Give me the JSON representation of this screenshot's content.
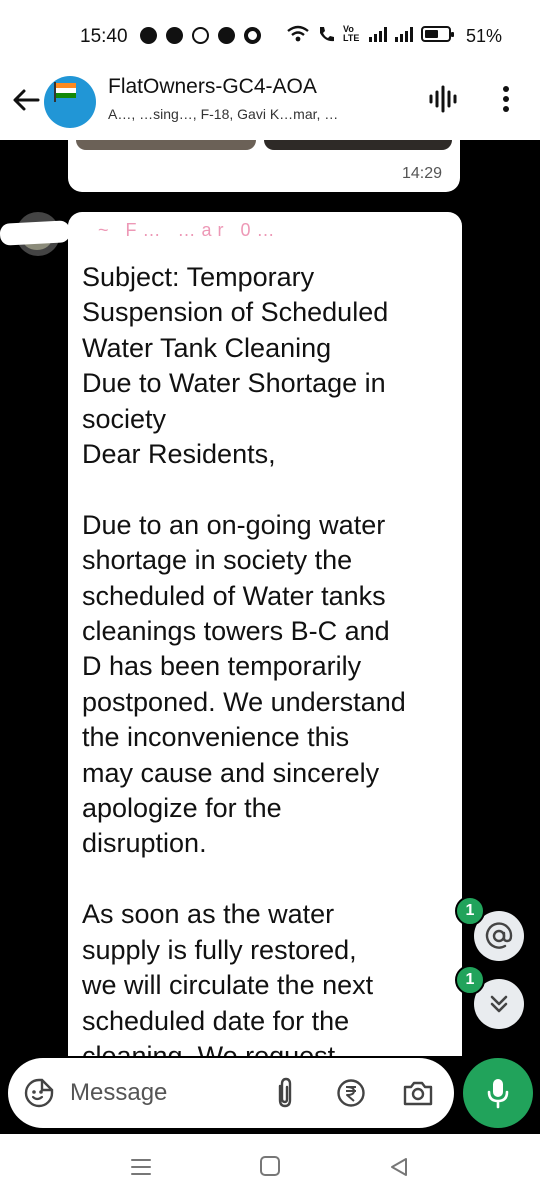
{
  "status_bar": {
    "time": "15:40",
    "network_label": "Vo LTE",
    "battery": "51%"
  },
  "header": {
    "group_name": "FlatOwners-GC4-AOA",
    "members": "A…, …sing…, F-18, Gavi K…mar, …"
  },
  "chat": {
    "previous_message_time": "14:29",
    "message": {
      "sender": "~ F… …ar 0…",
      "lines": [
        "Subject: Temporary",
        "Suspension of Scheduled",
        "Water Tank Cleaning",
        "Due to Water Shortage in",
        "society",
        "Dear Residents,",
        "",
        "Due to an on-going water",
        "shortage in society the",
        "scheduled of Water tanks",
        "cleanings towers B-C and",
        "D has been temporarily",
        "postponed. We understand",
        "the inconvenience this",
        "may cause and sincerely",
        "apologize for the",
        "disruption.",
        "",
        "As soon as the water",
        "supply is fully restored,",
        "we will circulate the next",
        "scheduled date for the",
        "cleaning. We request"
      ]
    },
    "mention_badge": "1",
    "scroll_badge": "1"
  },
  "composer": {
    "placeholder": "Message"
  },
  "icons": {
    "back": "arrow-left-icon",
    "voice": "voice-chat-icon",
    "more": "more-vert-icon",
    "emoji": "sticker-icon",
    "attach": "paperclip-icon",
    "payment": "rupee-icon",
    "camera": "camera-icon",
    "mic": "mic-icon",
    "mention": "at-icon",
    "scroll": "double-chevron-down-icon"
  },
  "colors": {
    "accent_green": "#21a35b",
    "sender_name": "#e0457b",
    "avatar_blue": "#2196d6"
  }
}
